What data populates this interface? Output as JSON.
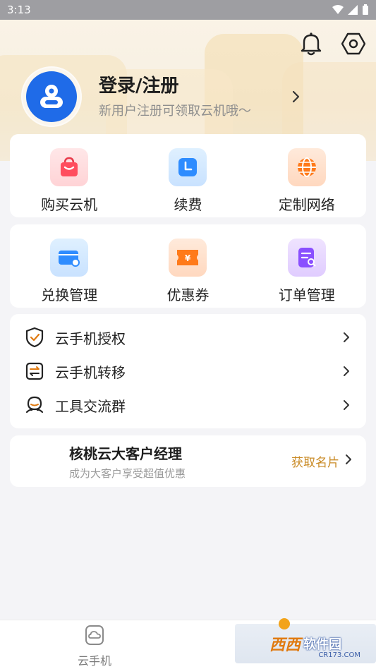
{
  "status_bar": {
    "time": "3:13"
  },
  "profile": {
    "title": "登录/注册",
    "subtitle": "新用户注册可领取云机哦～"
  },
  "grid_row_1": [
    {
      "label": "购买云机",
      "icon": "shopping-bag-icon"
    },
    {
      "label": "续费",
      "icon": "clock-icon"
    },
    {
      "label": "定制网络",
      "icon": "globe-icon"
    }
  ],
  "grid_row_2": [
    {
      "label": "兑换管理",
      "icon": "card-key-icon"
    },
    {
      "label": "优惠券",
      "icon": "coupon-icon"
    },
    {
      "label": "订单管理",
      "icon": "order-search-icon"
    }
  ],
  "list": [
    {
      "label": "云手机授权",
      "icon": "shield-check-icon"
    },
    {
      "label": "云手机转移",
      "icon": "transfer-icon"
    },
    {
      "label": "工具交流群",
      "icon": "chat-group-icon"
    }
  ],
  "manager": {
    "title": "核桃云大客户经理",
    "subtitle": "成为大客户享受超值优惠",
    "action": "获取名片"
  },
  "tabbar": {
    "tab_label": "云手机"
  },
  "watermark": {
    "main": "西西",
    "sub": "软件园",
    "url": "CR173.COM"
  },
  "colors": {
    "accent_blue": "#1f6be8",
    "action_orange": "#c98a24",
    "background": "#f4f4f7"
  }
}
